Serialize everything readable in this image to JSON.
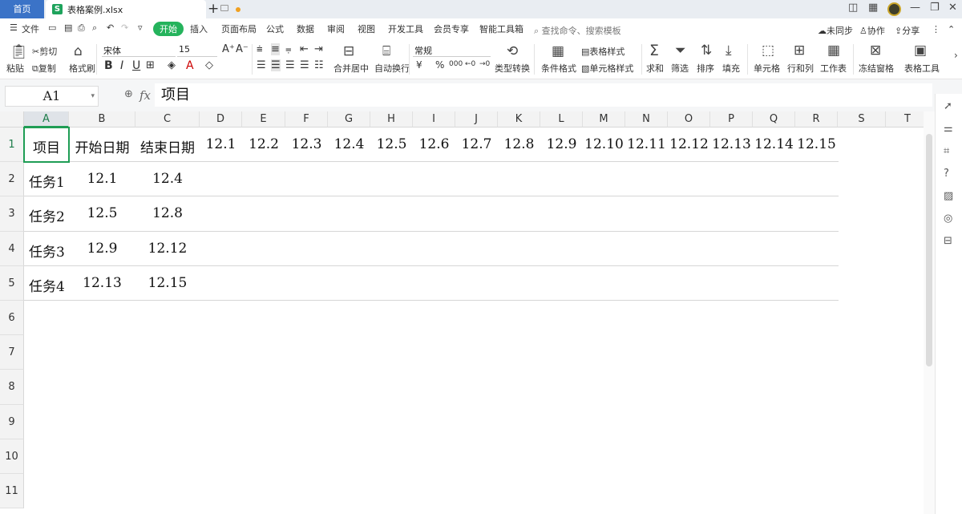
{
  "titlebar": {
    "home_tab": "首页",
    "file_icon": "S",
    "file_name": "表格案例.xlsx",
    "new_tab": "+"
  },
  "ribbon_tabs": [
    "文件",
    "开始",
    "插入",
    "页面布局",
    "公式",
    "数据",
    "审阅",
    "视图",
    "开发工具",
    "会员专享",
    "智能工具箱"
  ],
  "search_placeholder": "查找命令、搜索模板",
  "right_actions": {
    "sync": "未同步",
    "collab": "协作",
    "share": "分享"
  },
  "ribbon": {
    "paste": "粘贴",
    "cut": "剪切",
    "copy": "复制",
    "format_painter": "格式刷",
    "font_name": "宋体",
    "font_size": "15",
    "merge_center": "合并居中",
    "wrap_text": "自动换行",
    "number_format": "常规",
    "type_convert": "类型转换",
    "cond_format": "条件格式",
    "table_style": "表格样式",
    "cell_style": "单元格样式",
    "sum": "求和",
    "filter": "筛选",
    "sort": "排序",
    "fill": "填充",
    "cell": "单元格",
    "row_col": "行和列",
    "worksheet": "工作表",
    "freeze": "冻结窗格",
    "table_tools": "表格工具"
  },
  "formula_bar": {
    "name_box": "A1",
    "fx": "fx",
    "content": "项目"
  },
  "columns": [
    "A",
    "B",
    "C",
    "D",
    "E",
    "F",
    "G",
    "H",
    "I",
    "J",
    "K",
    "L",
    "M",
    "N",
    "O",
    "P",
    "Q",
    "R",
    "S",
    "T"
  ],
  "rows": [
    "1",
    "2",
    "3",
    "4",
    "5",
    "6",
    "7",
    "8",
    "9",
    "10",
    "11"
  ],
  "cells": {
    "header": [
      "项目",
      "开始日期",
      "结束日期",
      "12.1",
      "12.2",
      "12.3",
      "12.4",
      "12.5",
      "12.6",
      "12.7",
      "12.8",
      "12.9",
      "12.10",
      "12.11",
      "12.12",
      "12.13",
      "12.14",
      "12.15"
    ],
    "r2": [
      "任务1",
      "12.1",
      "12.4"
    ],
    "r3": [
      "任务2",
      "12.5",
      "12.8"
    ],
    "r4": [
      "任务3",
      "12.9",
      "12.12"
    ],
    "r5": [
      "任务4",
      "12.13",
      "12.15"
    ]
  }
}
